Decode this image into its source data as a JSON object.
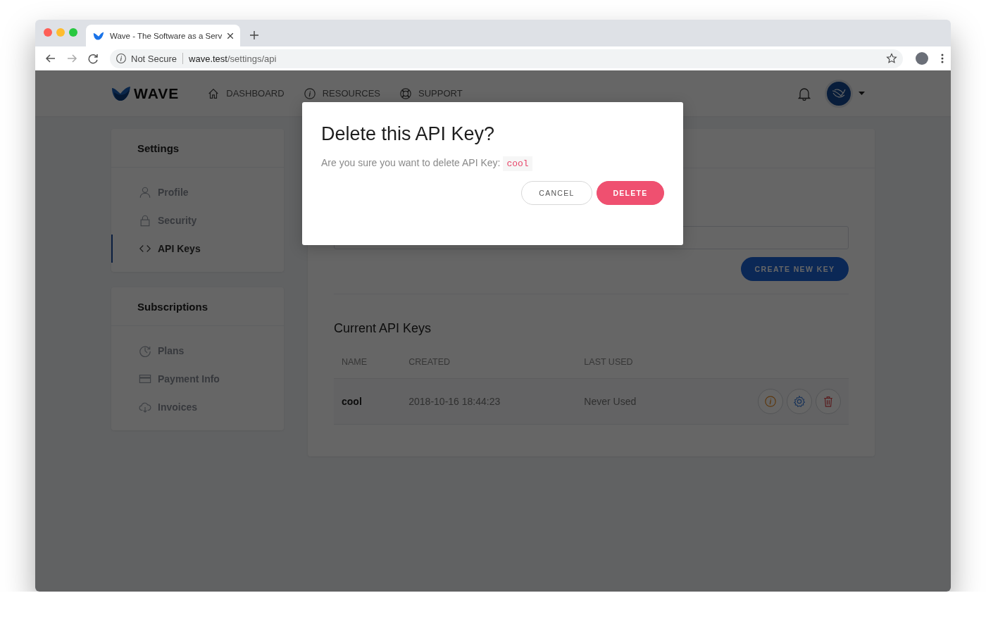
{
  "browser": {
    "tab_title": "Wave - The Software as a Serv",
    "security": "Not Secure",
    "host": "wave.test",
    "path": "/settings/api"
  },
  "header": {
    "brand": "WAVE",
    "links": [
      {
        "label": "DASHBOARD",
        "kind": "home"
      },
      {
        "label": "RESOURCES",
        "kind": "info"
      },
      {
        "label": "SUPPORT",
        "kind": "lifebuoy"
      }
    ]
  },
  "sidebar": [
    {
      "title": "Settings",
      "items": [
        {
          "label": "Profile",
          "kind": "user",
          "selected": false
        },
        {
          "label": "Security",
          "kind": "lock",
          "selected": false
        },
        {
          "label": "API Keys",
          "kind": "code",
          "selected": true
        }
      ]
    },
    {
      "title": "Subscriptions",
      "items": [
        {
          "label": "Plans",
          "kind": "clock",
          "selected": false
        },
        {
          "label": "Payment Info",
          "kind": "card",
          "selected": false
        },
        {
          "label": "Invoices",
          "kind": "cloud",
          "selected": false
        }
      ]
    }
  ],
  "main": {
    "create_button": "CREATE NEW KEY",
    "section_title": "Current API Keys",
    "table": {
      "columns": [
        "NAME",
        "CREATED",
        "LAST USED"
      ],
      "rows": [
        {
          "cells": [
            "cool",
            "2018-10-16 18:44:23",
            "Never Used"
          ],
          "actions": [
            {
              "kind": "info"
            },
            {
              "kind": "settings"
            },
            {
              "kind": "delete"
            }
          ]
        }
      ]
    }
  },
  "dialog": {
    "title": "Delete this API Key?",
    "message": "Are you sure you want to delete API Key:",
    "key": "cool",
    "buttons": [
      {
        "label": "CANCEL",
        "kind": "secondary"
      },
      {
        "label": "DELETE",
        "kind": "danger"
      }
    ]
  }
}
